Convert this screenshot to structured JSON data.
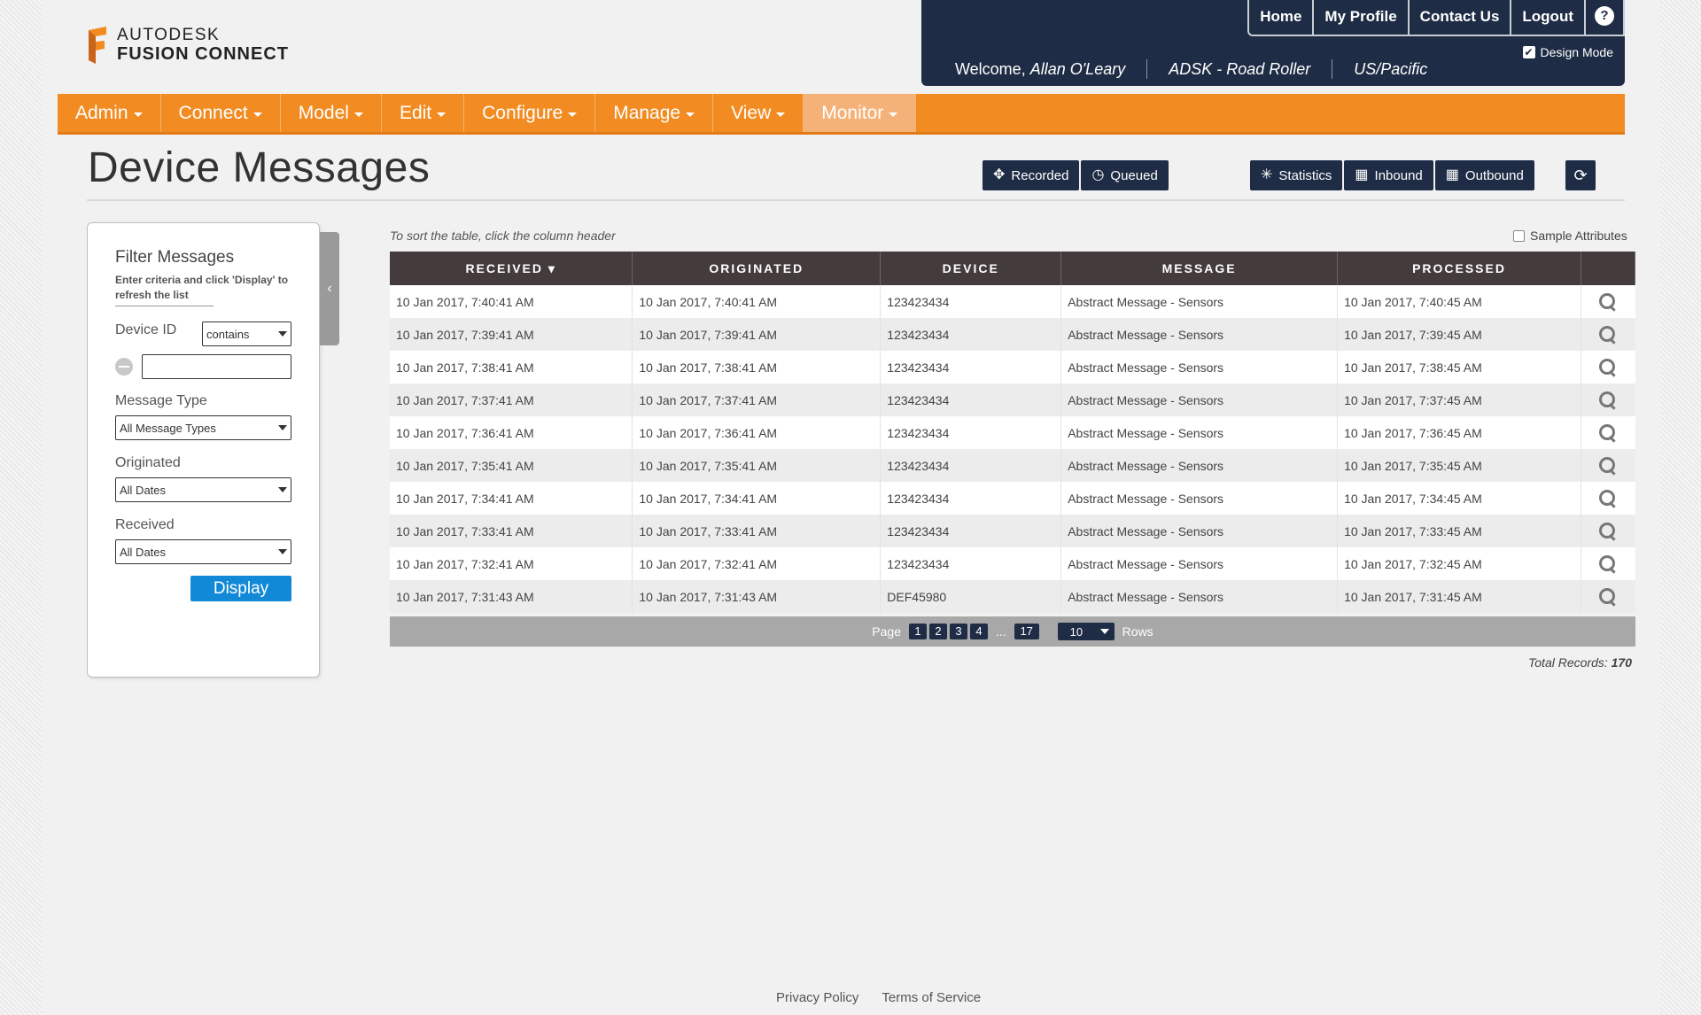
{
  "brand": {
    "line1": "AUTODESK",
    "line2": "FUSION CONNECT",
    "accent": "#f28c22"
  },
  "topnav": {
    "home": "Home",
    "profile": "My Profile",
    "contact": "Contact Us",
    "logout": "Logout",
    "help": "?"
  },
  "user": {
    "welcome": "Welcome,",
    "name": "Allan O'Leary",
    "company": "ADSK - Road Roller",
    "timezone": "US/Pacific"
  },
  "design_mode": {
    "label": "Design Mode",
    "checked": true
  },
  "mainnav": [
    "Admin",
    "Connect",
    "Model",
    "Edit",
    "Configure",
    "Manage",
    "View",
    "Monitor"
  ],
  "page": {
    "title": "Device Messages"
  },
  "toggles": {
    "recorded": "Recorded",
    "queued": "Queued",
    "statistics": "Statistics",
    "inbound": "Inbound",
    "outbound": "Outbound"
  },
  "filter": {
    "title": "Filter Messages",
    "hint": "Enter criteria and click 'Display' to refresh the list",
    "device_id_label": "Device ID",
    "device_id_op": "contains",
    "device_id_value": "",
    "message_type_label": "Message Type",
    "message_type": "All Message Types",
    "originated_label": "Originated",
    "originated": "All Dates",
    "received_label": "Received",
    "received": "All Dates",
    "display": "Display"
  },
  "table": {
    "sort_hint": "To sort the table, click the column header",
    "sample_attributes": "Sample Attributes",
    "columns": [
      "RECEIVED ▾",
      "ORIGINATED",
      "DEVICE",
      "MESSAGE",
      "PROCESSED"
    ],
    "rows": [
      [
        "10 Jan 2017, 7:40:41 AM",
        "10 Jan 2017, 7:40:41 AM",
        "123423434",
        "Abstract Message - Sensors",
        "10 Jan 2017, 7:40:45 AM"
      ],
      [
        "10 Jan 2017, 7:39:41 AM",
        "10 Jan 2017, 7:39:41 AM",
        "123423434",
        "Abstract Message - Sensors",
        "10 Jan 2017, 7:39:45 AM"
      ],
      [
        "10 Jan 2017, 7:38:41 AM",
        "10 Jan 2017, 7:38:41 AM",
        "123423434",
        "Abstract Message - Sensors",
        "10 Jan 2017, 7:38:45 AM"
      ],
      [
        "10 Jan 2017, 7:37:41 AM",
        "10 Jan 2017, 7:37:41 AM",
        "123423434",
        "Abstract Message - Sensors",
        "10 Jan 2017, 7:37:45 AM"
      ],
      [
        "10 Jan 2017, 7:36:41 AM",
        "10 Jan 2017, 7:36:41 AM",
        "123423434",
        "Abstract Message - Sensors",
        "10 Jan 2017, 7:36:45 AM"
      ],
      [
        "10 Jan 2017, 7:35:41 AM",
        "10 Jan 2017, 7:35:41 AM",
        "123423434",
        "Abstract Message - Sensors",
        "10 Jan 2017, 7:35:45 AM"
      ],
      [
        "10 Jan 2017, 7:34:41 AM",
        "10 Jan 2017, 7:34:41 AM",
        "123423434",
        "Abstract Message - Sensors",
        "10 Jan 2017, 7:34:45 AM"
      ],
      [
        "10 Jan 2017, 7:33:41 AM",
        "10 Jan 2017, 7:33:41 AM",
        "123423434",
        "Abstract Message - Sensors",
        "10 Jan 2017, 7:33:45 AM"
      ],
      [
        "10 Jan 2017, 7:32:41 AM",
        "10 Jan 2017, 7:32:41 AM",
        "123423434",
        "Abstract Message - Sensors",
        "10 Jan 2017, 7:32:45 AM"
      ],
      [
        "10 Jan 2017, 7:31:43 AM",
        "10 Jan 2017, 7:31:43 AM",
        "DEF45980",
        "Abstract Message - Sensors",
        "10 Jan 2017, 7:31:45 AM"
      ]
    ]
  },
  "pager": {
    "page_label": "Page",
    "pages": [
      "1",
      "2",
      "3",
      "4"
    ],
    "ellipsis": "...",
    "last": "17",
    "rows_value": "10",
    "rows_label": "Rows"
  },
  "total": {
    "label": "Total Records:",
    "value": "170"
  },
  "footer": {
    "privacy": "Privacy Policy",
    "terms": "Terms of Service"
  },
  "colors": {
    "navy": "#1e2c45",
    "orange": "#f28c22",
    "table_header": "#443b3c",
    "display_button": "#1289d6"
  }
}
